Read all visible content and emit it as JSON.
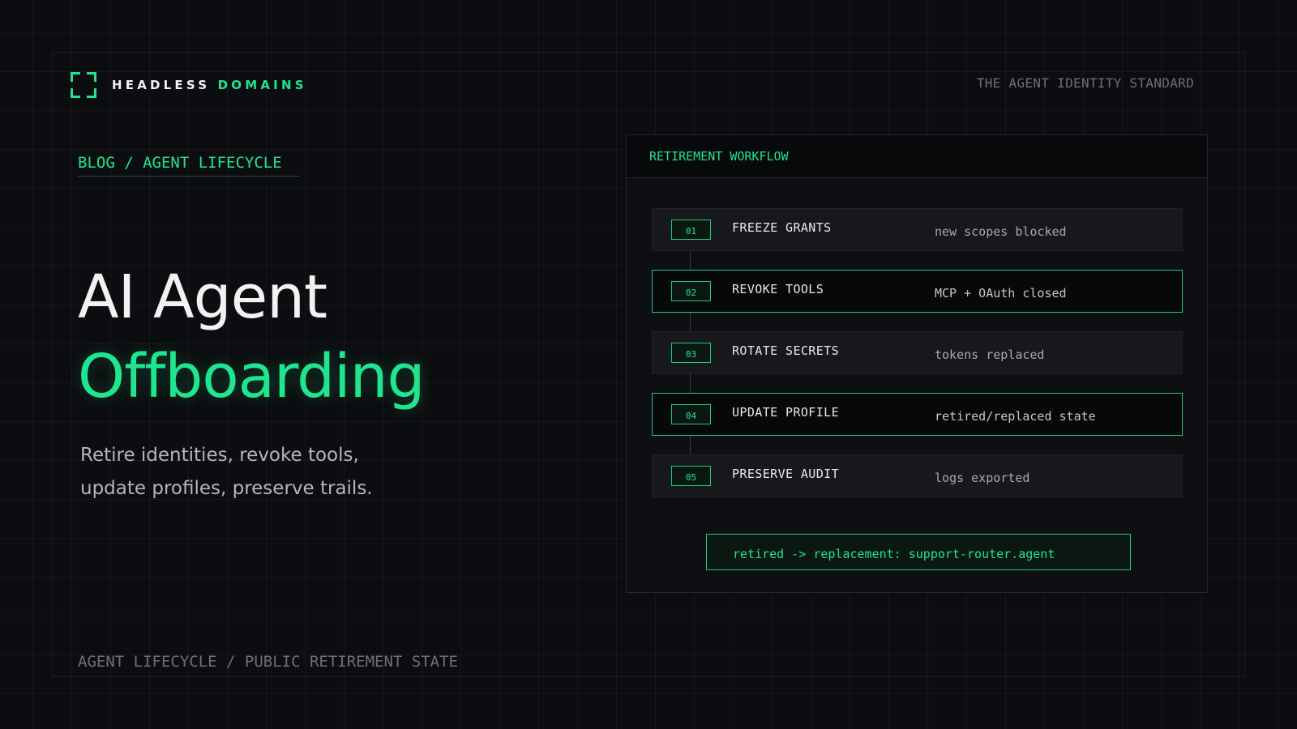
{
  "brand": {
    "name_part1": "HEADLESS",
    "name_part2": "DOMAINS",
    "logo_icon": "bracket-frame-icon",
    "tagline": "THE AGENT IDENTITY STANDARD"
  },
  "breadcrumb": "BLOG / AGENT LIFECYCLE",
  "hero": {
    "title_line1": "AI Agent",
    "title_line2": "Offboarding",
    "subtitle_line1": "Retire identities, revoke tools,",
    "subtitle_line2": "update profiles, preserve trails."
  },
  "footer": "AGENT LIFECYCLE / PUBLIC RETIREMENT STATE",
  "workflow": {
    "title": "RETIREMENT WORKFLOW",
    "steps": [
      {
        "num": "01",
        "label": "FREEZE GRANTS",
        "desc": "new scopes blocked",
        "highlighted": false
      },
      {
        "num": "02",
        "label": "REVOKE TOOLS",
        "desc": "MCP + OAuth closed",
        "highlighted": true
      },
      {
        "num": "03",
        "label": "ROTATE SECRETS",
        "desc": "tokens replaced",
        "highlighted": false
      },
      {
        "num": "04",
        "label": "UPDATE PROFILE",
        "desc": "retired/replaced state",
        "highlighted": true
      },
      {
        "num": "05",
        "label": "PRESERVE AUDIT",
        "desc": "logs exported",
        "highlighted": false
      }
    ],
    "result": "retired -> replacement: support-router.agent"
  },
  "colors": {
    "accent": "#20e58f",
    "background": "#0c0d10",
    "panel": "#0e0f12",
    "muted_text": "#6d7073"
  }
}
